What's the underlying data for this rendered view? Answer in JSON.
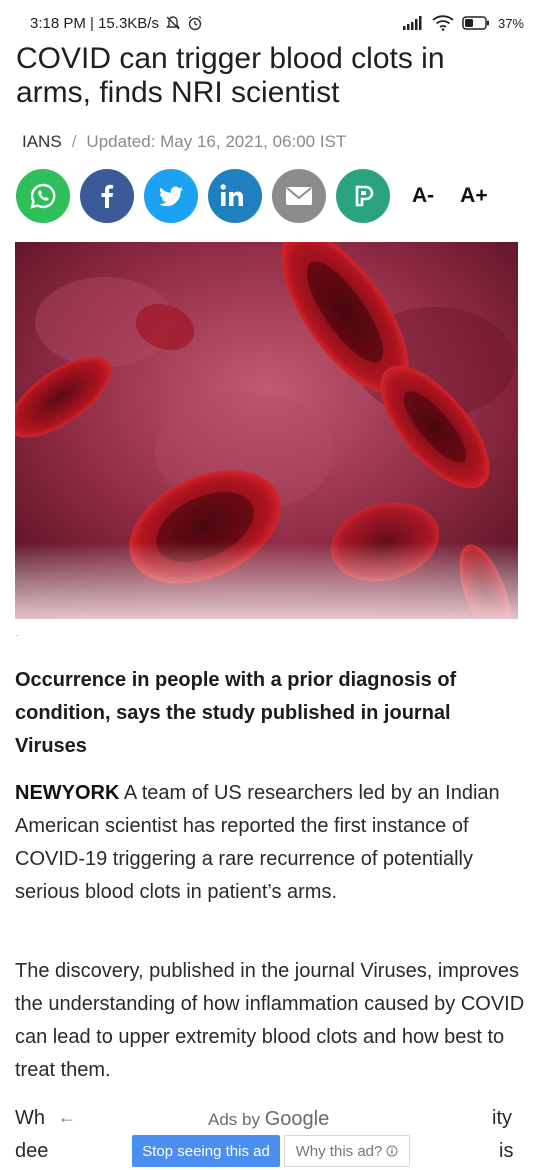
{
  "status": {
    "time": "3:18 PM | 15.3KB/s",
    "battery": "37%"
  },
  "article": {
    "headline": "COVID can trigger blood clots in arms, finds NRI scientist",
    "source": "IANS",
    "separator": "/",
    "updated": "Updated: May 16, 2021, 06:00 IST",
    "lede": "Occurrence in people with a prior diagnosis of condition, says the study published in journal Viruses",
    "dateline": "NEWYORK",
    "para1": "A team of US researchers led by an Indian American scientist has reported the first instance of COVID-19 triggering a rare recurrence of potentially serious blood clots in patient’s arms.",
    "para2": "The discovery, published in the journal Viruses, improves the understanding of how inflammation caused by COVID can lead to upper extremity blood clots and how best to treat them.",
    "dot": ".",
    "peek_left_1": "Wh",
    "peek_left_2": "dee",
    "peek_right_1": "ity",
    "peek_right_2": "is"
  },
  "share": {
    "font_decrease": "A-",
    "font_increase": "A+",
    "colors": {
      "whatsapp": "#2fbf5a",
      "facebook": "#3b5a9a",
      "twitter": "#1da1f2",
      "linkedin": "#1f7fbf",
      "email": "#8c8c8c",
      "other": "#2aa381"
    }
  },
  "ad": {
    "ads_by": "Ads by ",
    "google": "Google",
    "stop": "Stop seeing this ad",
    "why": "Why this ad?"
  }
}
